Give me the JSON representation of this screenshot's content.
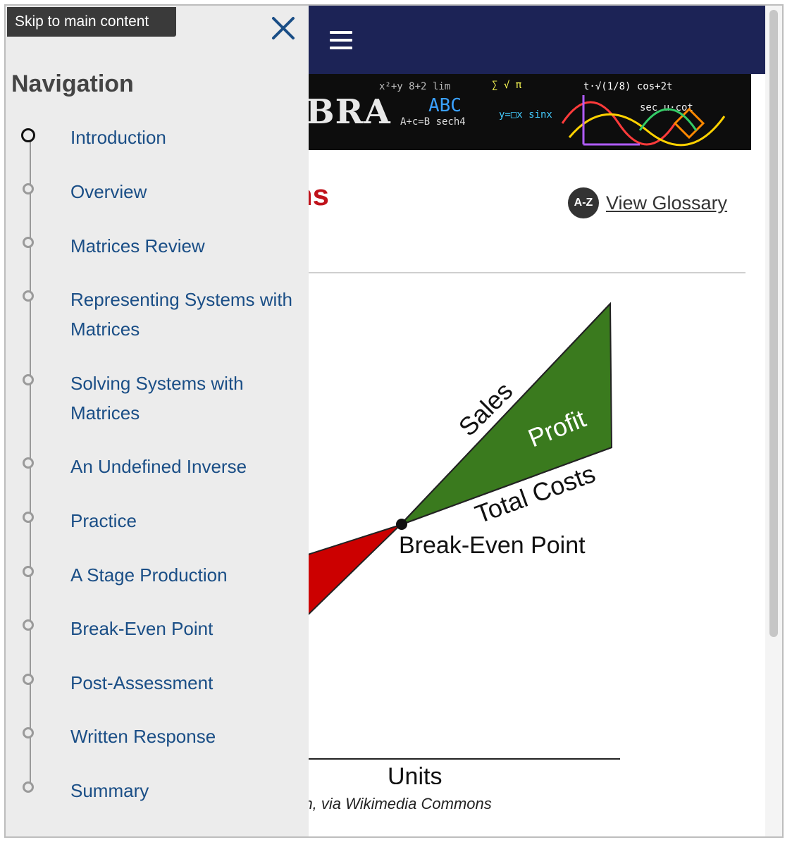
{
  "skip_link": "Skip to main content",
  "nav": {
    "heading": "Navigation",
    "items": [
      {
        "label": "Introduction",
        "active": true
      },
      {
        "label": "Overview"
      },
      {
        "label": "Matrices Review"
      },
      {
        "label": "Representing Systems with Matrices"
      },
      {
        "label": "Solving Systems with Matrices"
      },
      {
        "label": "An Undefined Inverse"
      },
      {
        "label": "Practice"
      },
      {
        "label": "A Stage Production"
      },
      {
        "label": "Break-Even Point"
      },
      {
        "label": "Post-Assessment"
      },
      {
        "label": "Written Response"
      },
      {
        "label": "Summary"
      }
    ]
  },
  "banner": {
    "word": "BRA"
  },
  "page": {
    "title_fragment": "ns"
  },
  "glossary": {
    "badge": "A-Z",
    "label": "View Glossary"
  },
  "diagram": {
    "sales_label": "Sales",
    "profit_label": "Profit",
    "costs_label": "Total Costs",
    "break_even_label": "Break-Even Point",
    "x_axis_label": "Units",
    "colors": {
      "profit": "#3a7a1e",
      "loss": "#cc0000"
    }
  },
  "caption": "rth, via Wikimedia Commons",
  "colors": {
    "topbar": "#1c2356",
    "title": "#c0121b",
    "nav_link": "#1a4e86"
  }
}
